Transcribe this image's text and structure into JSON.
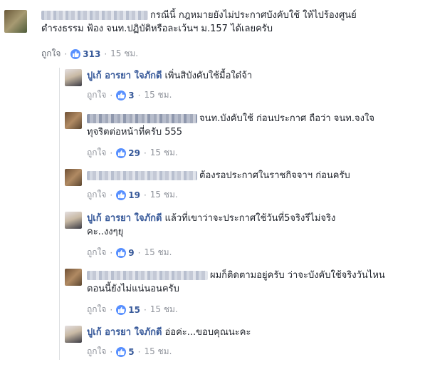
{
  "like_label": "ถูกใจ",
  "separator": "·",
  "main_comment": {
    "text_line1": "กรณีนี้ กฎหมายยังไม่ประกาศบังคับใช้ ให้ไปร้องศูนย์",
    "text_line2": "ดำรงธรรม ฟ้อง จนท.ปฏิบัติหรือละเว้นฯ ม.157 ได้เลยครับ",
    "reactions": "313",
    "time": "15 ชม."
  },
  "replies": [
    {
      "author": "ปูเก้ อารยา ใจภักดี",
      "text_line1": "เพิ่นสิบังคับใช้มื้อใด๋จ้า",
      "text_line2": "",
      "reactions": "3",
      "time": "15 ชม."
    },
    {
      "author": "",
      "text_line1": "จนท.บังคับใช้ ก่อนประกาศ ถือว่า จนท.จงใจ",
      "text_line2": "ทุจริตต่อหน้าที่ครับ 555",
      "reactions": "29",
      "time": "15 ชม."
    },
    {
      "author": "",
      "text_line1": "ต้องรอประกาศในราชกิจจาฯ ก่อนครับ",
      "text_line2": "",
      "reactions": "19",
      "time": "15 ชม."
    },
    {
      "author": "ปูเก้ อารยา ใจภักดี",
      "text_line1": "แล้วที่เขาว่าจะประกาศใช้วันที่5จริงรึไม่จริง",
      "text_line2": "คะ..งงๆยุ",
      "reactions": "9",
      "time": "15 ชม."
    },
    {
      "author": "",
      "text_line1": "ผมก็ติดตามอยู่ครับ ว่าจะบังคับใช้จริงวันไหน",
      "text_line2": "ตอนนี้ยังไม่แน่นอนครับ",
      "reactions": "15",
      "time": "15 ชม."
    },
    {
      "author": "ปูเก้ อารยา ใจภักดี",
      "text_line1": "อ่อค่ะ...ขอบคุณนะคะ",
      "text_line2": "",
      "reactions": "5",
      "time": "15 ชม."
    }
  ],
  "colors": {
    "link": "#365899",
    "meta": "#90949c",
    "reaction": "#5890ff"
  }
}
